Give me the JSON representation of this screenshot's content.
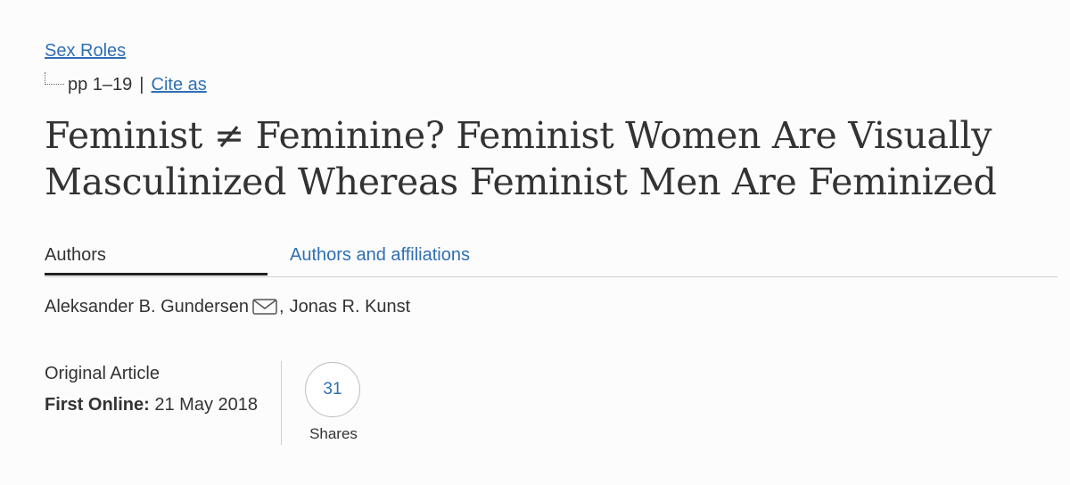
{
  "journal": {
    "name": "Sex Roles"
  },
  "citation": {
    "pages": "pp 1–19",
    "separator": "|",
    "cite_label": "Cite as"
  },
  "article": {
    "title": "Feminist ≠ Feminine? Feminist Women Are Visually Masculinized Whereas Feminist Men Are Feminized"
  },
  "tabs": [
    {
      "label": "Authors",
      "active": true
    },
    {
      "label": "Authors and affiliations",
      "active": false
    }
  ],
  "authors": {
    "first": "Aleksander B. Gundersen",
    "comma": ",",
    "second": "Jonas R. Kunst",
    "contact_icon": "envelope-icon"
  },
  "meta": {
    "article_type": "Original Article",
    "first_online_label": "First Online:",
    "first_online_date": "21 May 2018"
  },
  "shares": {
    "count": "31",
    "label": "Shares"
  },
  "colors": {
    "link": "#2f6fb3",
    "text": "#333333",
    "background": "#fcfcfc"
  }
}
